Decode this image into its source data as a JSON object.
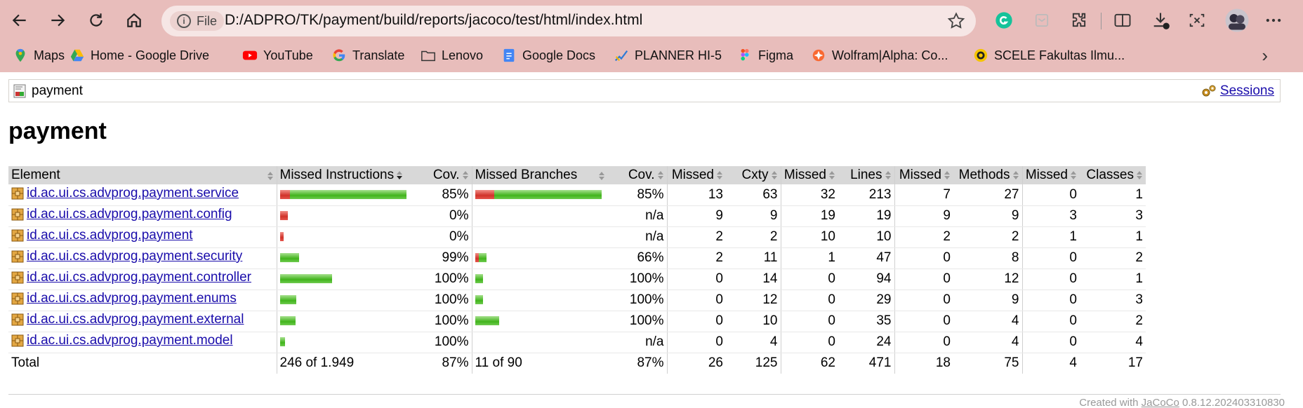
{
  "browser": {
    "address_label": "File",
    "url": "D:/ADPRO/TK/payment/build/reports/jacoco/test/html/index.html",
    "bookmarks": [
      {
        "label": "Maps"
      },
      {
        "label": "Home - Google Drive"
      },
      {
        "label": "YouTube"
      },
      {
        "label": "Translate"
      },
      {
        "label": "Lenovo"
      },
      {
        "label": "Google Docs"
      },
      {
        "label": "PLANNER HI-5"
      },
      {
        "label": "Figma"
      },
      {
        "label": "Wolfram|Alpha: Co..."
      },
      {
        "label": "SCELE Fakultas Ilmu..."
      }
    ],
    "more": "›"
  },
  "report": {
    "breadcrumb": "payment",
    "sessions_link": "Sessions",
    "title": "payment",
    "columns": {
      "element": "Element",
      "missed_instructions": "Missed Instructions",
      "cov1": "Cov.",
      "missed_branches": "Missed Branches",
      "cov2": "Cov.",
      "missed_cxty": "Missed",
      "cxty": "Cxty",
      "missed_lines": "Missed",
      "lines": "Lines",
      "missed_methods": "Missed",
      "methods": "Methods",
      "missed_classes": "Missed",
      "classes": "Classes"
    },
    "rows": [
      {
        "element": "id.ac.ui.cs.advprog.payment.service",
        "instr_cov": "85%",
        "br_cov": "85%",
        "missed_cxty": "13",
        "cxty": "63",
        "missed_lines": "32",
        "lines": "213",
        "missed_methods": "7",
        "methods": "27",
        "missed_classes": "0",
        "classes": "1",
        "instr_bar": {
          "missed": 0.08,
          "covered": 0.92
        },
        "br_bar": {
          "missed": 0.15,
          "covered": 0.85
        }
      },
      {
        "element": "id.ac.ui.cs.advprog.payment.config",
        "instr_cov": "0%",
        "br_cov": "n/a",
        "missed_cxty": "9",
        "cxty": "9",
        "missed_lines": "19",
        "lines": "19",
        "missed_methods": "9",
        "methods": "9",
        "missed_classes": "3",
        "classes": "3",
        "instr_bar": {
          "missed": 0.06,
          "covered": 0.0
        },
        "br_bar": {
          "missed": 0,
          "covered": 0
        }
      },
      {
        "element": "id.ac.ui.cs.advprog.payment",
        "instr_cov": "0%",
        "br_cov": "n/a",
        "missed_cxty": "2",
        "cxty": "2",
        "missed_lines": "10",
        "lines": "10",
        "missed_methods": "2",
        "methods": "2",
        "missed_classes": "1",
        "classes": "1",
        "instr_bar": {
          "missed": 0.03,
          "covered": 0.0
        },
        "br_bar": {
          "missed": 0,
          "covered": 0
        }
      },
      {
        "element": "id.ac.ui.cs.advprog.payment.security",
        "instr_cov": "99%",
        "br_cov": "66%",
        "missed_cxty": "2",
        "cxty": "11",
        "missed_lines": "1",
        "lines": "47",
        "missed_methods": "0",
        "methods": "8",
        "missed_classes": "0",
        "classes": "2",
        "instr_bar": {
          "missed": 0.0,
          "covered": 0.15
        },
        "br_bar": {
          "missed": 0.03,
          "covered": 0.06
        }
      },
      {
        "element": "id.ac.ui.cs.advprog.payment.controller",
        "instr_cov": "100%",
        "br_cov": "100%",
        "missed_cxty": "0",
        "cxty": "14",
        "missed_lines": "0",
        "lines": "94",
        "missed_methods": "0",
        "methods": "12",
        "missed_classes": "0",
        "classes": "1",
        "instr_bar": {
          "missed": 0.0,
          "covered": 0.41
        },
        "br_bar": {
          "missed": 0.0,
          "covered": 0.06
        }
      },
      {
        "element": "id.ac.ui.cs.advprog.payment.enums",
        "instr_cov": "100%",
        "br_cov": "100%",
        "missed_cxty": "0",
        "cxty": "12",
        "missed_lines": "0",
        "lines": "29",
        "missed_methods": "0",
        "methods": "9",
        "missed_classes": "0",
        "classes": "3",
        "instr_bar": {
          "missed": 0.0,
          "covered": 0.13
        },
        "br_bar": {
          "missed": 0.0,
          "covered": 0.06
        }
      },
      {
        "element": "id.ac.ui.cs.advprog.payment.external",
        "instr_cov": "100%",
        "br_cov": "100%",
        "missed_cxty": "0",
        "cxty": "10",
        "missed_lines": "0",
        "lines": "35",
        "missed_methods": "0",
        "methods": "4",
        "missed_classes": "0",
        "classes": "2",
        "instr_bar": {
          "missed": 0.0,
          "covered": 0.12
        },
        "br_bar": {
          "missed": 0.0,
          "covered": 0.19
        }
      },
      {
        "element": "id.ac.ui.cs.advprog.payment.model",
        "instr_cov": "100%",
        "br_cov": "n/a",
        "missed_cxty": "0",
        "cxty": "4",
        "missed_lines": "0",
        "lines": "24",
        "missed_methods": "0",
        "methods": "4",
        "missed_classes": "0",
        "classes": "4",
        "instr_bar": {
          "missed": 0.0,
          "covered": 0.04
        },
        "br_bar": {
          "missed": 0,
          "covered": 0
        }
      }
    ],
    "total": {
      "label": "Total",
      "instr": "246 of 1.949",
      "instr_cov": "87%",
      "br": "11 of 90",
      "br_cov": "87%",
      "missed_cxty": "26",
      "cxty": "125",
      "missed_lines": "62",
      "lines": "471",
      "missed_methods": "18",
      "methods": "75",
      "missed_classes": "4",
      "classes": "17"
    },
    "footer": {
      "prefix": "Created with ",
      "link": "JaCoCo",
      "version": " 0.8.12.202403310830"
    }
  },
  "colors": {
    "chrome": "#e8bdbb",
    "header": "#d8d8d8",
    "bar_missed": "#d1322a",
    "bar_covered": "#41b41c"
  }
}
